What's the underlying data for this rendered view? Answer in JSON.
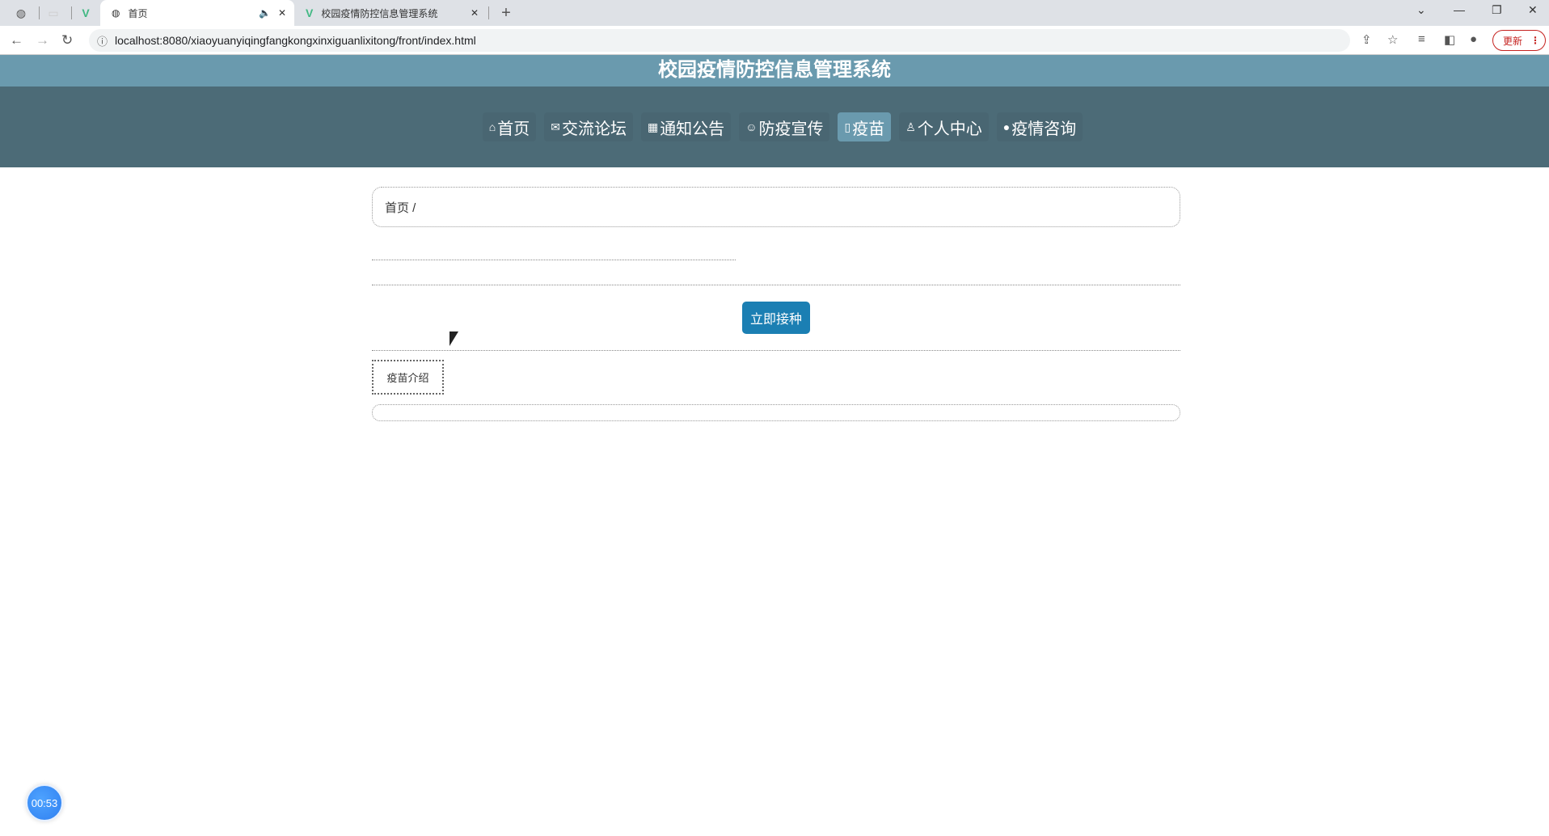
{
  "browser": {
    "tabs": [
      {
        "title": "首页",
        "active": true
      },
      {
        "title": "校园疫情防控信息管理系统",
        "active": false
      }
    ],
    "url": "localhost:8080/xiaoyuanyiqingfangkongxinxiguanlixitong/front/index.html",
    "update_label": "更新"
  },
  "header": {
    "title": "校园疫情防控信息管理系统"
  },
  "nav": {
    "items": [
      {
        "label": "首页",
        "icon": "⌂"
      },
      {
        "label": "交流论坛",
        "icon": "✉"
      },
      {
        "label": "通知公告",
        "icon": "▦"
      },
      {
        "label": "防疫宣传",
        "icon": "☺"
      },
      {
        "label": "疫苗",
        "icon": "▯"
      },
      {
        "label": "个人中心",
        "icon": "♙"
      },
      {
        "label": "疫情咨询",
        "icon": "●"
      }
    ],
    "active_index": 4
  },
  "breadcrumb": {
    "text": "首页 /"
  },
  "main": {
    "vaccinate_button": "立即接种",
    "intro_tab": "疫苗介绍"
  },
  "timer": {
    "text": "00:53"
  },
  "colors": {
    "title_band": "#6a9aae",
    "nav_band": "#4c6b77",
    "button": "#1b7fb3"
  }
}
